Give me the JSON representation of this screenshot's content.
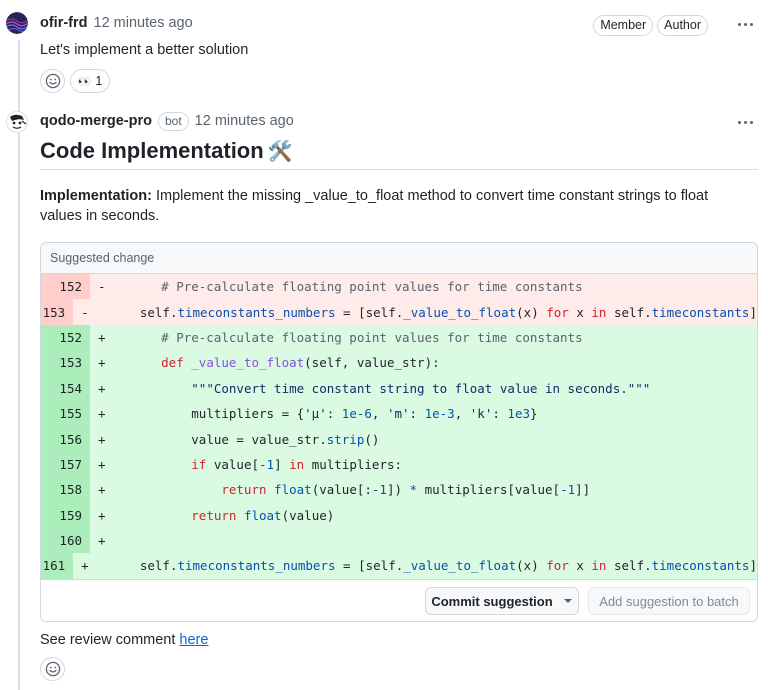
{
  "comment1": {
    "author": "ofir-frd",
    "time": "12 minutes ago",
    "badges": [
      "Member",
      "Author"
    ],
    "body": "Let's implement a better solution",
    "reaction": {
      "emoji": "👀",
      "count": "1"
    }
  },
  "comment2": {
    "author": "qodo-merge-pro",
    "bot_label": "bot",
    "time": "12 minutes ago",
    "title": "Code Implementation",
    "title_emoji": "🛠️",
    "impl_label": "Implementation:",
    "impl_text": "Implement the missing _value_to_float method to convert time constant strings to float values in seconds.",
    "suggestion_header": "Suggested change",
    "commit_label": "Commit suggestion",
    "batch_label": "Add suggestion to batch",
    "see_review_prefix": "See review comment",
    "see_review_link": "here"
  },
  "diff": [
    {
      "ln": "152",
      "sign": "-",
      "type": "del"
    },
    {
      "ln": "153",
      "sign": "-",
      "type": "del"
    },
    {
      "ln": "152",
      "sign": "+",
      "type": "add"
    },
    {
      "ln": "153",
      "sign": "+",
      "type": "add"
    },
    {
      "ln": "154",
      "sign": "+",
      "type": "add"
    },
    {
      "ln": "155",
      "sign": "+",
      "type": "add"
    },
    {
      "ln": "156",
      "sign": "+",
      "type": "add"
    },
    {
      "ln": "157",
      "sign": "+",
      "type": "add"
    },
    {
      "ln": "158",
      "sign": "+",
      "type": "add"
    },
    {
      "ln": "159",
      "sign": "+",
      "type": "add"
    },
    {
      "ln": "160",
      "sign": "+",
      "type": "add"
    },
    {
      "ln": "161",
      "sign": "+",
      "type": "add"
    }
  ],
  "code_tokens": {
    "c_precalc": "# Pre-calculate floating point values for time constants",
    "self": "self",
    "dot": ".",
    "timeconstants_numbers": "timeconstants_numbers",
    "assign_open": " = [self.",
    "value_to_float": "_value_to_float",
    "x_paren": "(x) ",
    "for": "for",
    "x": " x ",
    "in": "in",
    "self_dot": " self.",
    "timeconstants": "timeconstants",
    "close": "]",
    "def": "def",
    "def_args": "(self, value_str):",
    "docstring": "\"\"\"Convert time constant string to float value in seconds.\"\"\"",
    "multipliers_assign": "multipliers = {",
    "mu": "'µ'",
    "colon_sp": ": ",
    "n1e6": "1e-6",
    "comma_sp": ", ",
    "m": "'m'",
    "n1e3m": "1e-3",
    "k": "'k'",
    "n1e3": "1e3",
    "close_brace": "}",
    "value_assign": "value = value_str.",
    "strip": "strip",
    "parens": "()",
    "if": "if",
    "value_idx_open": " value[",
    "neg1": "-1",
    "idx_close_sp": "] ",
    "multipliers_colon": " multipliers:",
    "return": "return",
    "float": "float",
    "value_slice_open": "(value[:",
    "slice_close": "]) ",
    "star": "*",
    "multipliers_value": " multipliers[value[",
    "double_close": "]]",
    "value_paren": "(value)"
  }
}
